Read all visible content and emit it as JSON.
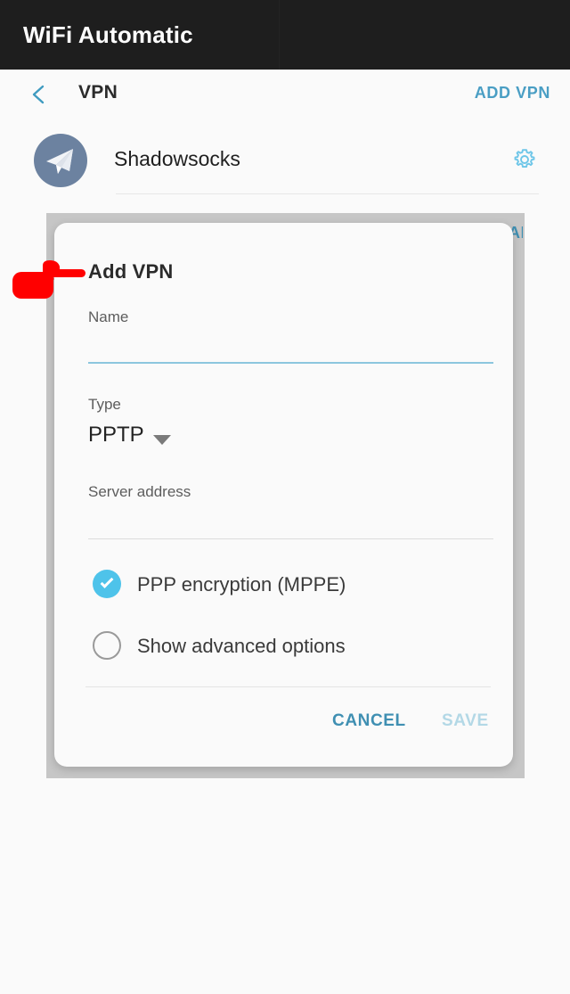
{
  "window": {
    "app_title": "WiFi Automatic"
  },
  "actionbar": {
    "back_icon": "chevron-left-icon",
    "title": "VPN",
    "action_label": "ADD VPN",
    "accent_color": "#4a9ec4"
  },
  "vpn_list": {
    "items": [
      {
        "name": "Shadowsocks",
        "avatar_icon": "paper-plane-icon",
        "avatar_color": "#6c82a0",
        "settings_icon": "gear-icon",
        "settings_icon_color": "#6ec6e8"
      }
    ]
  },
  "dialog": {
    "title": "Add VPN",
    "fields": [
      {
        "label": "Name",
        "value": "",
        "placeholder": "",
        "state": "active"
      },
      {
        "label": "Type",
        "value": "PPTP",
        "control": "dropdown"
      },
      {
        "label": "Server address",
        "value": "",
        "placeholder": "",
        "state": "idle"
      }
    ],
    "checkboxes": [
      {
        "label": "PPP encryption (MPPE)",
        "checked": true,
        "color": "#4ec3ea"
      },
      {
        "label": "Show advanced options",
        "checked": false,
        "color": "#9a9a9a"
      }
    ],
    "buttons": {
      "cancel": "CANCEL",
      "save": "SAVE",
      "cancel_color": "#3f8fb2",
      "save_color": "#b3d8e6",
      "save_enabled": false
    }
  },
  "annotation": {
    "pointer_icon": "pointing-hand-icon",
    "pointer_color": "#ff0000",
    "points_at": "Add VPN"
  }
}
